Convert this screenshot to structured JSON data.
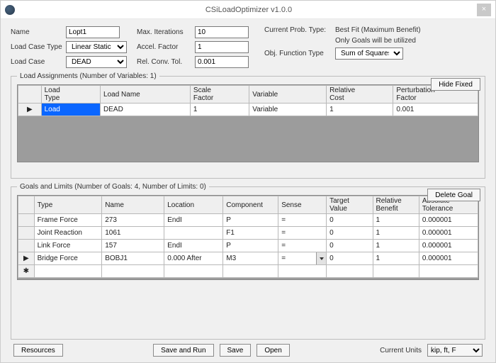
{
  "title": "CSiLoadOptimizer v1.0.0",
  "form": {
    "name_label": "Name",
    "name_value": "Lopt1",
    "lct_label": "Load Case Type",
    "lct_value": "Linear Static",
    "lc_label": "Load Case",
    "lc_value": "DEAD",
    "maxit_label": "Max. Iterations",
    "maxit_value": "10",
    "af_label": "Accel. Factor",
    "af_value": "1",
    "rct_label": "Rel. Conv. Tol.",
    "rct_value": "0.001",
    "cpt_label": "Current Prob. Type:",
    "cpt_value": "Best Fit (Maximum Benefit)",
    "cpt_note": "Only Goals will be utilized",
    "oft_label": "Obj. Function Type",
    "oft_value": "Sum of Squares"
  },
  "la": {
    "legend": "Load Assignments   (Number of Variables: 1)",
    "hide_fixed": "Hide Fixed",
    "headers": {
      "lt": "Load\nType",
      "ln": "Load Name",
      "sf": "Scale\nFactor",
      "var": "Variable",
      "rc": "Relative\nCost",
      "pf": "Perturbation\nFactor"
    },
    "rows": [
      {
        "marker": "▶",
        "lt": "Load",
        "ln": "DEAD",
        "sf": "1",
        "var": "Variable",
        "rc": "1",
        "pf": "0.001"
      }
    ]
  },
  "gl": {
    "legend": "Goals and Limits   (Number of Goals: 4,  Number of Limits: 0)",
    "delete_goal": "Delete Goal",
    "headers": {
      "type": "Type",
      "name": "Name",
      "loc": "Location",
      "comp": "Component",
      "sense": "Sense",
      "tv": "Target\nValue",
      "rb": "Relative\nBenefit",
      "at": "Absolute\nTolerance"
    },
    "rows": [
      {
        "marker": "",
        "type": "Frame Force",
        "name": "273",
        "loc": "EndI",
        "comp": "P",
        "sense": "=",
        "tv": "0",
        "rb": "1",
        "at": "0.000001"
      },
      {
        "marker": "",
        "type": "Joint Reaction",
        "name": "1061",
        "loc": "",
        "comp": "F1",
        "sense": "=",
        "tv": "0",
        "rb": "1",
        "at": "0.000001"
      },
      {
        "marker": "",
        "type": "Link Force",
        "name": "157",
        "loc": "EndI",
        "comp": "P",
        "sense": "=",
        "tv": "0",
        "rb": "1",
        "at": "0.000001"
      },
      {
        "marker": "▶",
        "type": "Bridge Force",
        "name": "BOBJ1",
        "loc": "0.000 After",
        "comp": "M3",
        "sense": "=",
        "tv": "0",
        "rb": "1",
        "at": "0.000001",
        "sense_dd": true
      },
      {
        "marker": "✱",
        "type": "",
        "name": "",
        "loc": "",
        "comp": "",
        "sense": "",
        "tv": "",
        "rb": "",
        "at": ""
      }
    ]
  },
  "footer": {
    "resources": "Resources",
    "save_run": "Save and Run",
    "save": "Save",
    "open": "Open",
    "units_label": "Current Units",
    "units_value": "kip, ft, F"
  }
}
